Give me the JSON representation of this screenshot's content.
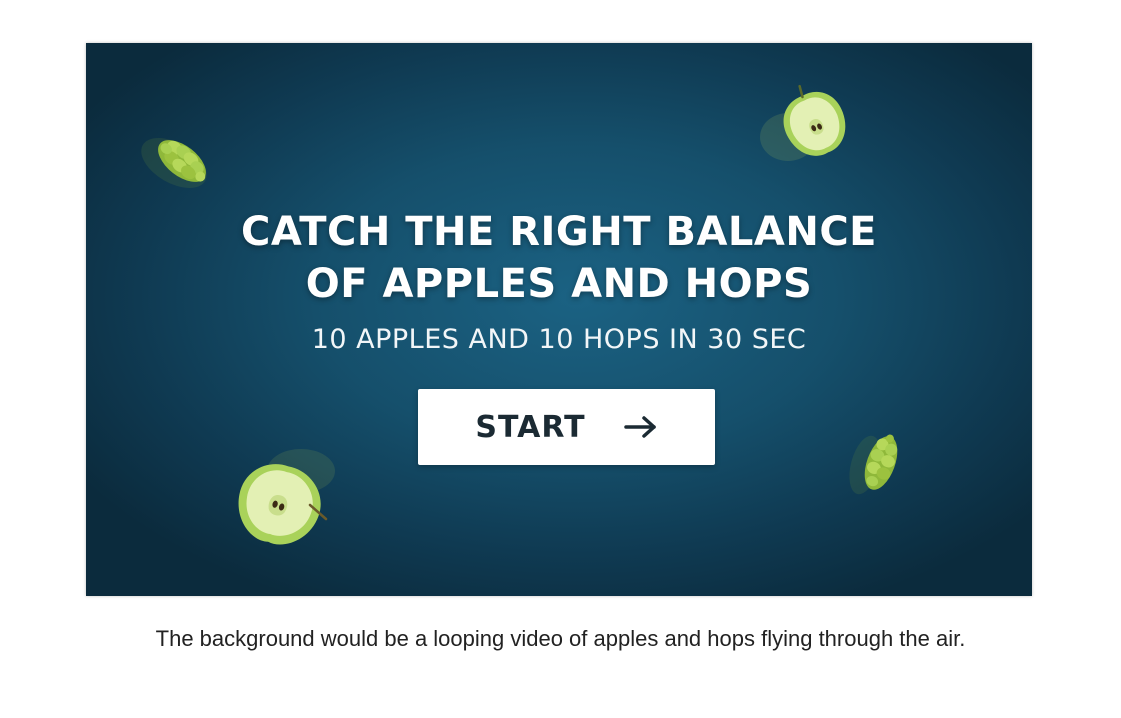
{
  "game": {
    "title_line1": "CATCH THE RIGHT BALANCE",
    "title_line2": "OF APPLES AND HOPS",
    "subtitle": "10 APPLES AND 10 HOPS IN 30 SEC",
    "start_label": "START",
    "start_icon": "arrow-right-icon",
    "sprites": [
      "hop-icon",
      "apple-icon",
      "apple-icon",
      "hop-icon"
    ]
  },
  "caption": "The background would be a looping video of apples and hops flying through the air.",
  "colors": {
    "background_center": "#1b6283",
    "background_edge": "#0b2b3d",
    "title_text": "#ffffff",
    "button_background": "#ffffff",
    "button_text": "#1b2a33",
    "apple_green": "#a9d25a",
    "hop_green": "#9cc23f"
  }
}
